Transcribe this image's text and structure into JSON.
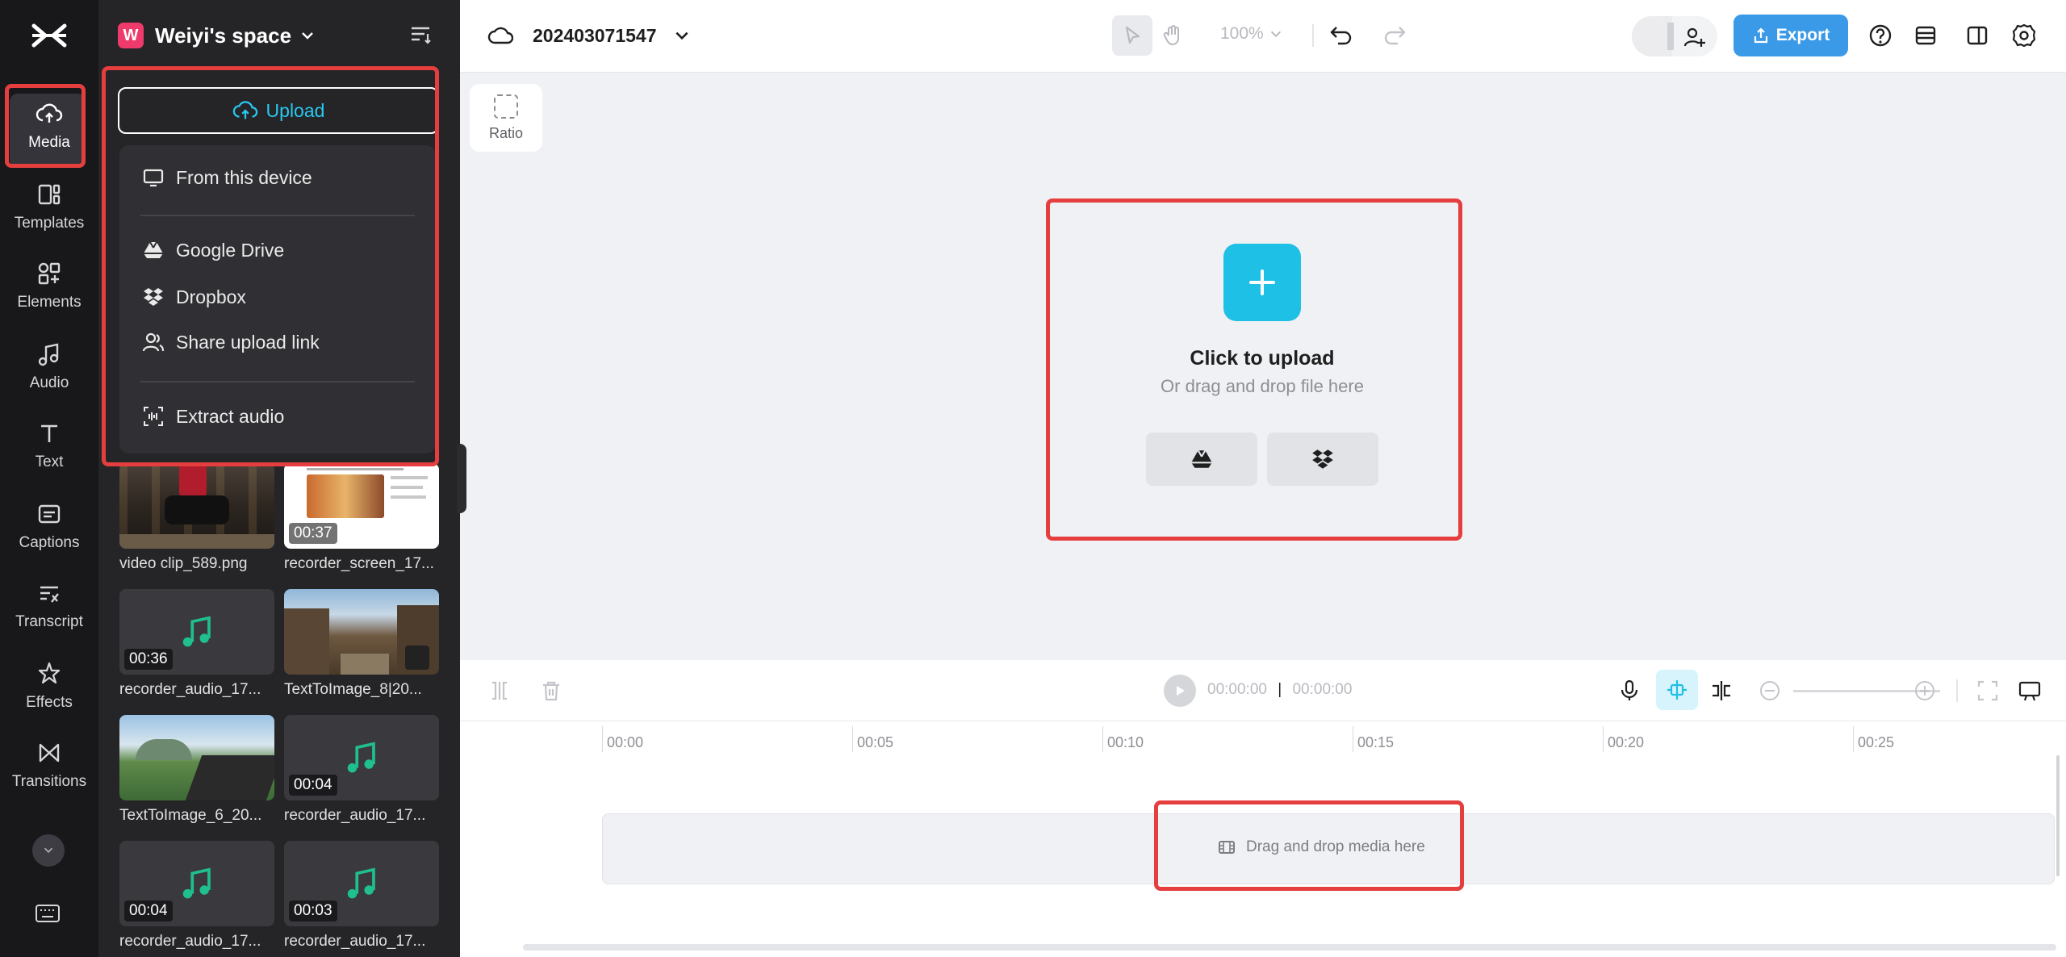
{
  "rail": {
    "items": [
      {
        "label": "Media",
        "icon": "cloud-upload-icon",
        "active": true
      },
      {
        "label": "Templates",
        "icon": "templates-icon"
      },
      {
        "label": "Elements",
        "icon": "elements-icon"
      },
      {
        "label": "Audio",
        "icon": "music-note-icon"
      },
      {
        "label": "Text",
        "icon": "text-icon"
      },
      {
        "label": "Captions",
        "icon": "captions-icon"
      },
      {
        "label": "Transcript",
        "icon": "transcript-icon"
      },
      {
        "label": "Effects",
        "icon": "effects-icon"
      },
      {
        "label": "Transitions",
        "icon": "transitions-icon"
      }
    ]
  },
  "panel": {
    "space_initial": "W",
    "space_name": "Weiyi's space",
    "upload_label": "Upload",
    "dropdown": {
      "from_device": "From this device",
      "google_drive": "Google Drive",
      "dropbox": "Dropbox",
      "share_link": "Share upload link",
      "extract_audio": "Extract audio"
    },
    "media": [
      {
        "name": "video clip_589.png",
        "duration": "",
        "kind": "image"
      },
      {
        "name": "recorder_screen_17...",
        "duration": "00:37",
        "kind": "screen"
      },
      {
        "name": "recorder_audio_17...",
        "duration": "00:36",
        "kind": "audio"
      },
      {
        "name": "TextToImage_8|20...",
        "duration": "",
        "kind": "street"
      },
      {
        "name": "TextToImage_6_20...",
        "duration": "",
        "kind": "landscape"
      },
      {
        "name": "recorder_audio_17...",
        "duration": "00:04",
        "kind": "audio"
      },
      {
        "name": "recorder_audio_17...",
        "duration": "00:04",
        "kind": "audio"
      },
      {
        "name": "recorder_audio_17...",
        "duration": "00:03",
        "kind": "audio"
      }
    ]
  },
  "topbar": {
    "project_name": "202403071547",
    "zoom": "100%",
    "export_label": "Export"
  },
  "canvas": {
    "ratio_label": "Ratio",
    "click_to_upload": "Click to upload",
    "drag_drop_hint": "Or drag and drop file here"
  },
  "timeline": {
    "current_time": "00:00:00",
    "total_time": "00:00:00",
    "ruler": [
      "00:00",
      "00:05",
      "00:10",
      "00:15",
      "00:20",
      "00:25"
    ],
    "drop_label": "Drag and drop media here"
  },
  "colors": {
    "accent": "#1ec0e6",
    "export": "#3b9ae8",
    "highlight": "#e53e3e",
    "audio_note": "#1fbf8f"
  }
}
